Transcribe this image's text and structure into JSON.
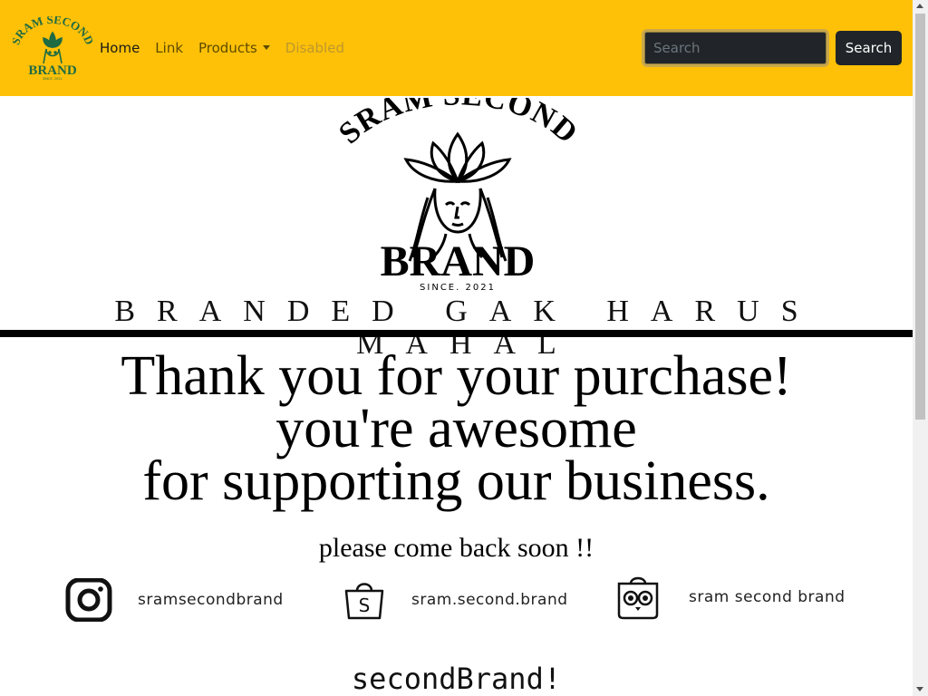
{
  "navbar": {
    "background": "#ffc107",
    "logo": {
      "top_text": "SRAM SECOND",
      "bottom_text": "BRAND",
      "since": "SINCE. 2021"
    },
    "links": [
      {
        "label": "Home",
        "state": "active"
      },
      {
        "label": "Link",
        "state": "normal"
      },
      {
        "label": "Products",
        "state": "dropdown"
      },
      {
        "label": "Disabled",
        "state": "disabled"
      }
    ],
    "search": {
      "placeholder": "Search",
      "button_label": "Search"
    }
  },
  "hero": {
    "logo": {
      "top_text": "SRAM SECOND",
      "bottom_text": "BRAND",
      "since": "SINCE. 2021"
    },
    "tagline": "BRANDED GAK HARUS MAHAL"
  },
  "message": {
    "line1": "Thank you for your purchase!",
    "line2": "you're awesome",
    "line3": "for supporting our business.",
    "comeback": "please come back soon !!"
  },
  "socials": [
    {
      "icon": "instagram-icon",
      "label": "sramsecondbrand"
    },
    {
      "icon": "shopee-icon",
      "label": "sram.second.brand"
    },
    {
      "icon": "tokopedia-icon",
      "label": "sram second brand"
    }
  ],
  "footer": {
    "brand": "secondBrand!"
  }
}
